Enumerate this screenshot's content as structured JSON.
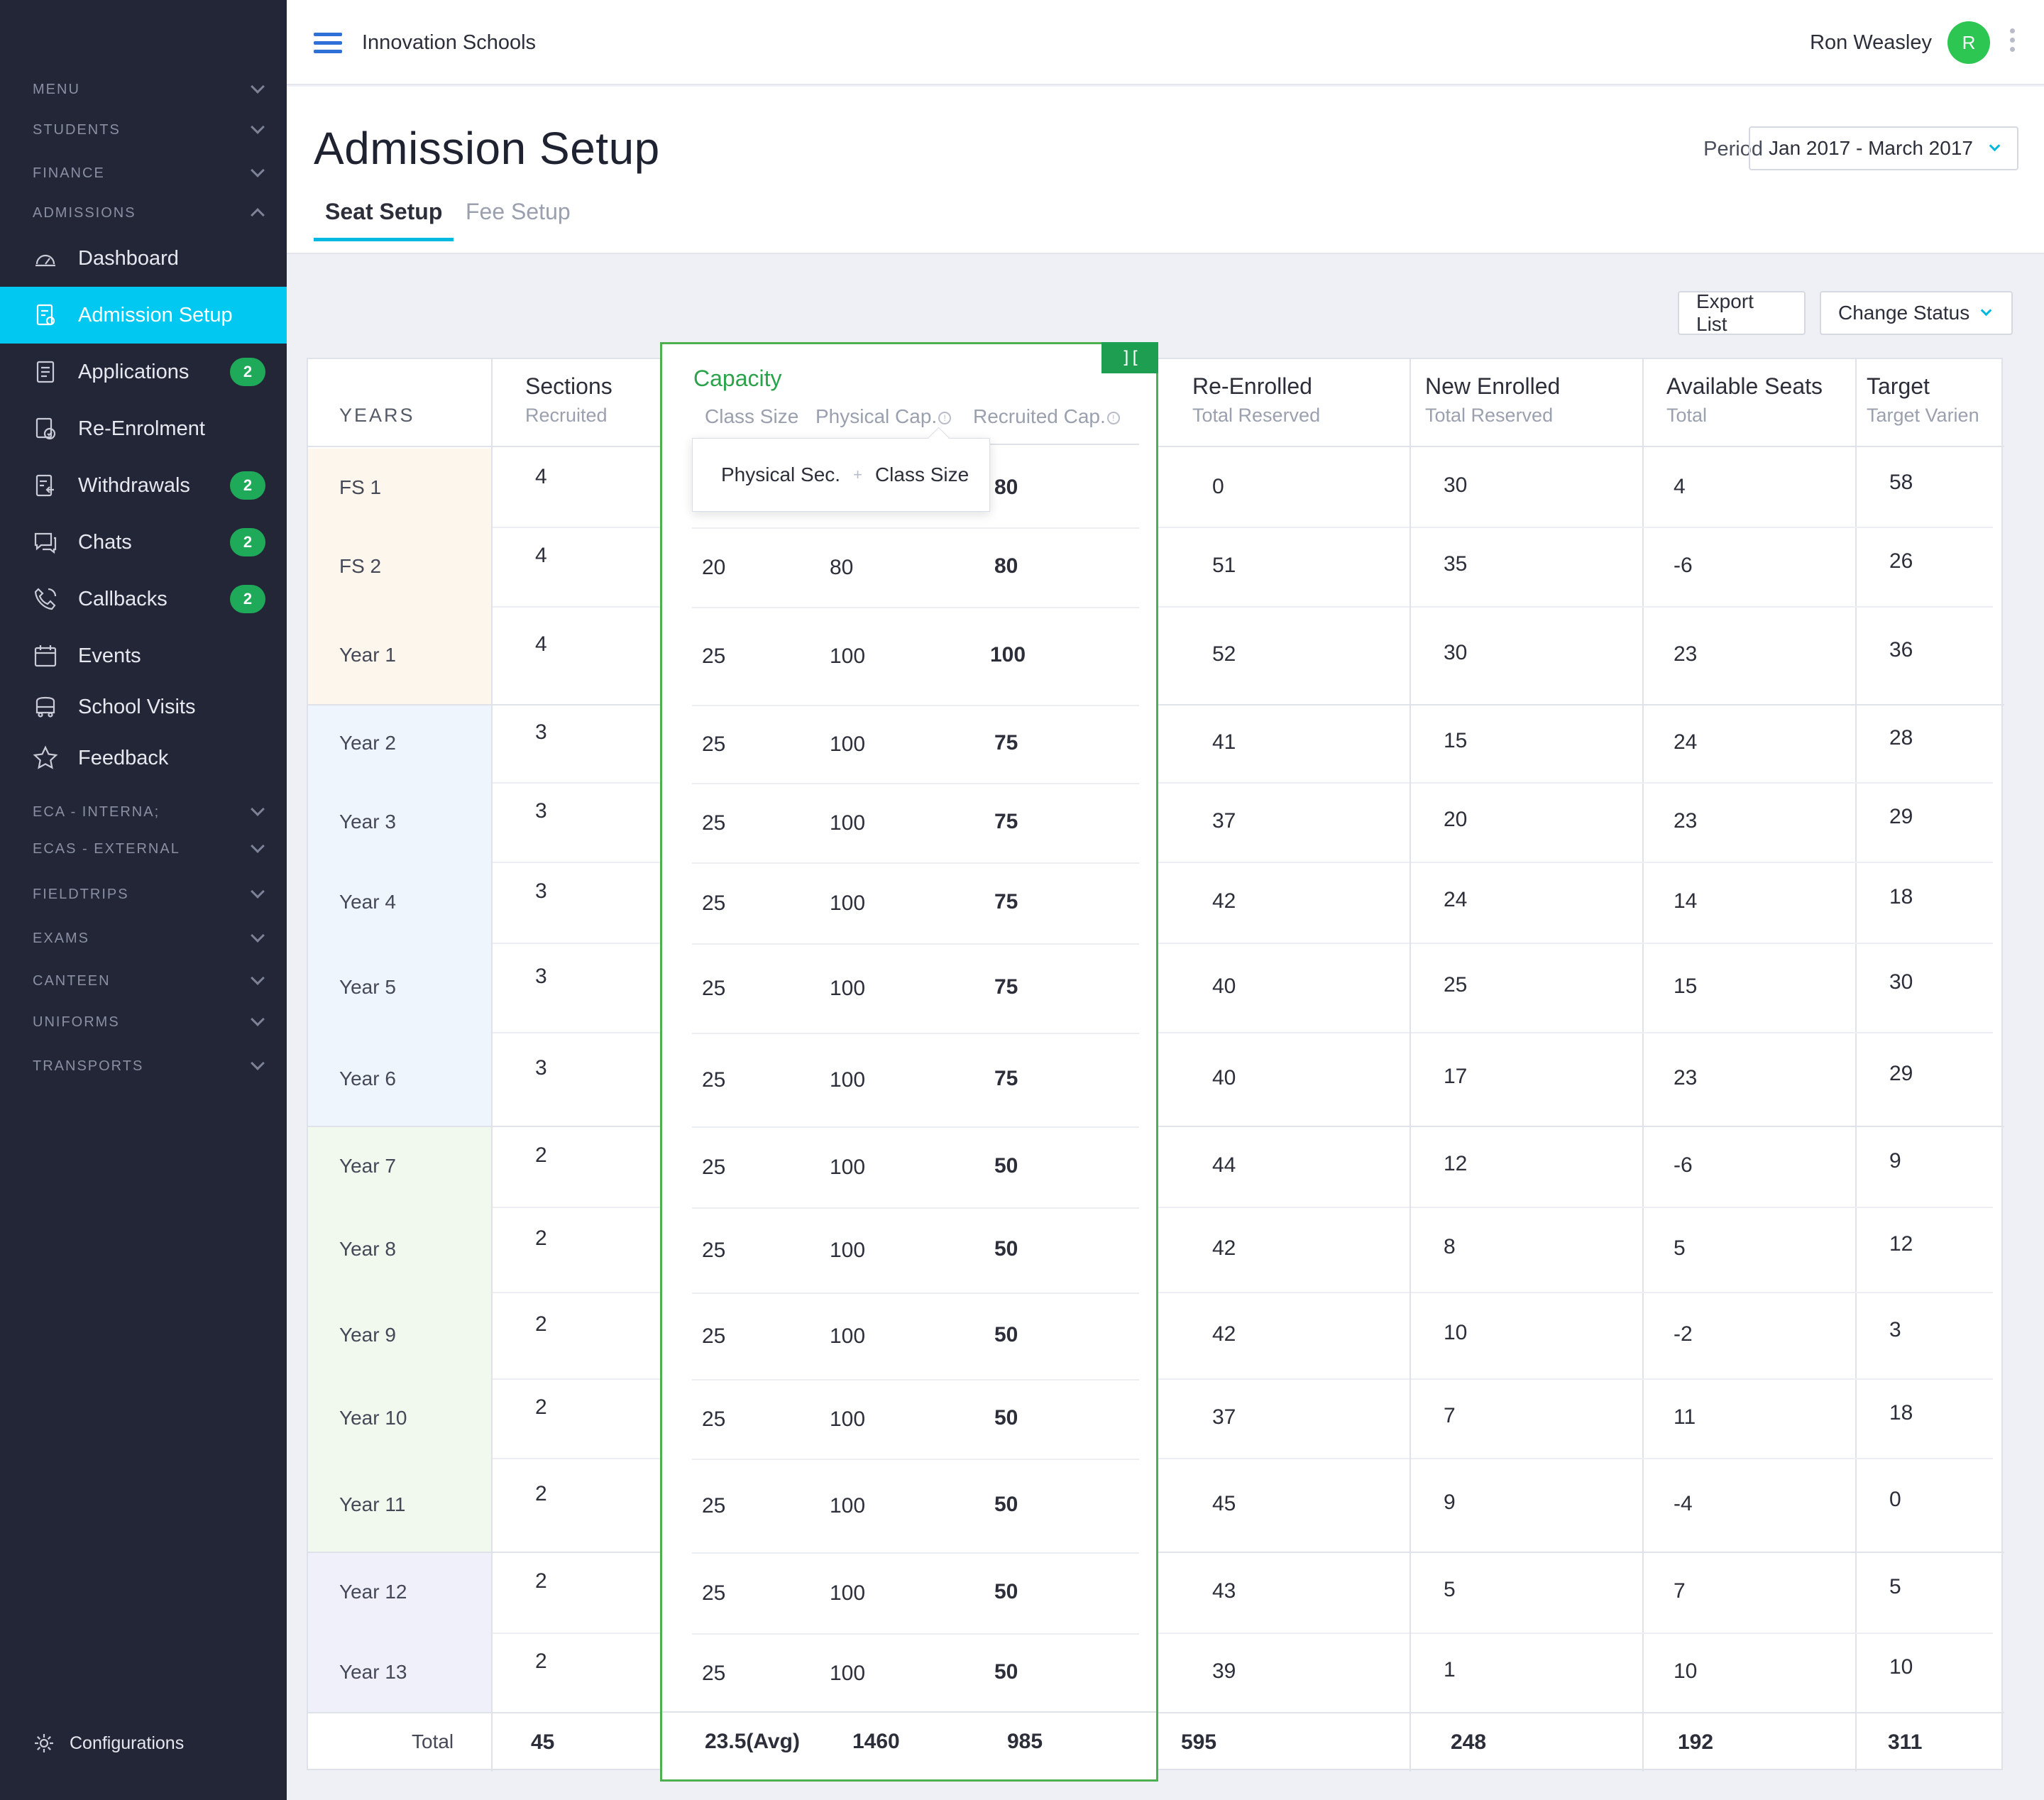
{
  "sidebar": {
    "sections_top": [
      {
        "label": "MENU",
        "expanded": false
      },
      {
        "label": "STUDENTS",
        "expanded": false
      },
      {
        "label": "FINANCE",
        "expanded": false
      },
      {
        "label": "ADMISSIONS",
        "expanded": true
      }
    ],
    "items": [
      {
        "label": "Dashboard",
        "icon": "dashboard-icon",
        "active": false,
        "badge": ""
      },
      {
        "label": "Admission Setup",
        "icon": "admission-setup-icon",
        "active": true,
        "badge": ""
      },
      {
        "label": "Applications",
        "icon": "applications-icon",
        "active": false,
        "badge": "2"
      },
      {
        "label": "Re-Enrolment",
        "icon": "re-enrolment-icon",
        "active": false,
        "badge": ""
      },
      {
        "label": "Withdrawals",
        "icon": "withdrawals-icon",
        "active": false,
        "badge": "2"
      },
      {
        "label": "Chats",
        "icon": "chats-icon",
        "active": false,
        "badge": "2"
      },
      {
        "label": "Callbacks",
        "icon": "callbacks-icon",
        "active": false,
        "badge": "2"
      },
      {
        "label": "Events",
        "icon": "calendar-icon",
        "active": false,
        "badge": ""
      },
      {
        "label": "School Visits",
        "icon": "bus-icon",
        "active": false,
        "badge": ""
      },
      {
        "label": "Feedback",
        "icon": "star-icon",
        "active": false,
        "badge": ""
      }
    ],
    "sections_bottom": [
      {
        "label": "ECA - INTERNA;"
      },
      {
        "label": "ECAS - EXTERNAL"
      },
      {
        "label": "FIELDTRIPS"
      },
      {
        "label": "EXAMS"
      },
      {
        "label": "CANTEEN"
      },
      {
        "label": "UNIFORMS"
      },
      {
        "label": "TRANSPORTS"
      }
    ],
    "configurations": {
      "label": "Configurations",
      "icon": "gear-icon"
    }
  },
  "topbar": {
    "school": "Innovation Schools",
    "user_name": "Ron Weasley",
    "avatar_initial": "R"
  },
  "page": {
    "title": "Admission Setup",
    "tabs": [
      {
        "label": "Seat Setup",
        "active": true
      },
      {
        "label": "Fee Setup",
        "active": false
      }
    ],
    "period_label": "Period",
    "period_value": "Jan 2017 - March 2017"
  },
  "toolbar": {
    "export_label": "Export List",
    "status_label": "Change Status"
  },
  "table": {
    "years_header": "YEARS",
    "headers": {
      "sections": {
        "main": "Sections",
        "sub": "Recruited"
      },
      "re_enrolled": {
        "main": "Re-Enrolled",
        "sub": "Total Reserved"
      },
      "new_enrolled": {
        "main": "New Enrolled",
        "sub": "Total Reserved"
      },
      "available": {
        "main": "Available Seats",
        "sub": "Total"
      },
      "target": {
        "main": "Target",
        "sub": "Target Varien"
      }
    },
    "capacity": {
      "title": "Capacity",
      "tag": "][",
      "sub_class_size": "Class Size",
      "sub_physical": "Physical Cap.",
      "sub_recruited": "Recruited Cap.",
      "tooltip_left": "Physical Sec.",
      "tooltip_plus": "+",
      "tooltip_right": "Class Size"
    },
    "rows": [
      {
        "year": "FS 1",
        "sections": "4",
        "class_size": "",
        "physical": "",
        "recruited": "80",
        "re_enrolled": "0",
        "new_enrolled": "30",
        "available": "4",
        "target": "58"
      },
      {
        "year": "FS 2",
        "sections": "4",
        "class_size": "20",
        "physical": "80",
        "recruited": "80",
        "re_enrolled": "51",
        "new_enrolled": "35",
        "available": "-6",
        "target": "26"
      },
      {
        "year": "Year 1",
        "sections": "4",
        "class_size": "25",
        "physical": "100",
        "recruited": "100",
        "re_enrolled": "52",
        "new_enrolled": "30",
        "available": "23",
        "target": "36"
      },
      {
        "year": "Year 2",
        "sections": "3",
        "class_size": "25",
        "physical": "100",
        "recruited": "75",
        "re_enrolled": "41",
        "new_enrolled": "15",
        "available": "24",
        "target": "28"
      },
      {
        "year": "Year 3",
        "sections": "3",
        "class_size": "25",
        "physical": "100",
        "recruited": "75",
        "re_enrolled": "37",
        "new_enrolled": "20",
        "available": "23",
        "target": "29"
      },
      {
        "year": "Year 4",
        "sections": "3",
        "class_size": "25",
        "physical": "100",
        "recruited": "75",
        "re_enrolled": "42",
        "new_enrolled": "24",
        "available": "14",
        "target": "18"
      },
      {
        "year": "Year 5",
        "sections": "3",
        "class_size": "25",
        "physical": "100",
        "recruited": "75",
        "re_enrolled": "40",
        "new_enrolled": "25",
        "available": "15",
        "target": "30"
      },
      {
        "year": "Year 6",
        "sections": "3",
        "class_size": "25",
        "physical": "100",
        "recruited": "75",
        "re_enrolled": "40",
        "new_enrolled": "17",
        "available": "23",
        "target": "29"
      },
      {
        "year": "Year 7",
        "sections": "2",
        "class_size": "25",
        "physical": "100",
        "recruited": "50",
        "re_enrolled": "44",
        "new_enrolled": "12",
        "available": "-6",
        "target": "9"
      },
      {
        "year": "Year 8",
        "sections": "2",
        "class_size": "25",
        "physical": "100",
        "recruited": "50",
        "re_enrolled": "42",
        "new_enrolled": "8",
        "available": "5",
        "target": "12"
      },
      {
        "year": "Year 9",
        "sections": "2",
        "class_size": "25",
        "physical": "100",
        "recruited": "50",
        "re_enrolled": "42",
        "new_enrolled": "10",
        "available": "-2",
        "target": "3"
      },
      {
        "year": "Year 10",
        "sections": "2",
        "class_size": "25",
        "physical": "100",
        "recruited": "50",
        "re_enrolled": "37",
        "new_enrolled": "7",
        "available": "11",
        "target": "18"
      },
      {
        "year": "Year 11",
        "sections": "2",
        "class_size": "25",
        "physical": "100",
        "recruited": "50",
        "re_enrolled": "45",
        "new_enrolled": "9",
        "available": "-4",
        "target": "0"
      },
      {
        "year": "Year 12",
        "sections": "2",
        "class_size": "25",
        "physical": "100",
        "recruited": "50",
        "re_enrolled": "43",
        "new_enrolled": "5",
        "available": "7",
        "target": "5"
      },
      {
        "year": "Year 13",
        "sections": "2",
        "class_size": "25",
        "physical": "100",
        "recruited": "50",
        "re_enrolled": "39",
        "new_enrolled": "1",
        "available": "10",
        "target": "10"
      }
    ],
    "totals": {
      "label": "Total",
      "sections": "45",
      "class_size": "23.5(Avg)",
      "physical": "1460",
      "recruited": "985",
      "re_enrolled": "595",
      "new_enrolled": "248",
      "available": "192",
      "target": "311"
    },
    "group_colors": [
      "#fdf6ec",
      "#eef5fc",
      "#f1f8ee",
      "#eff0fa"
    ]
  }
}
